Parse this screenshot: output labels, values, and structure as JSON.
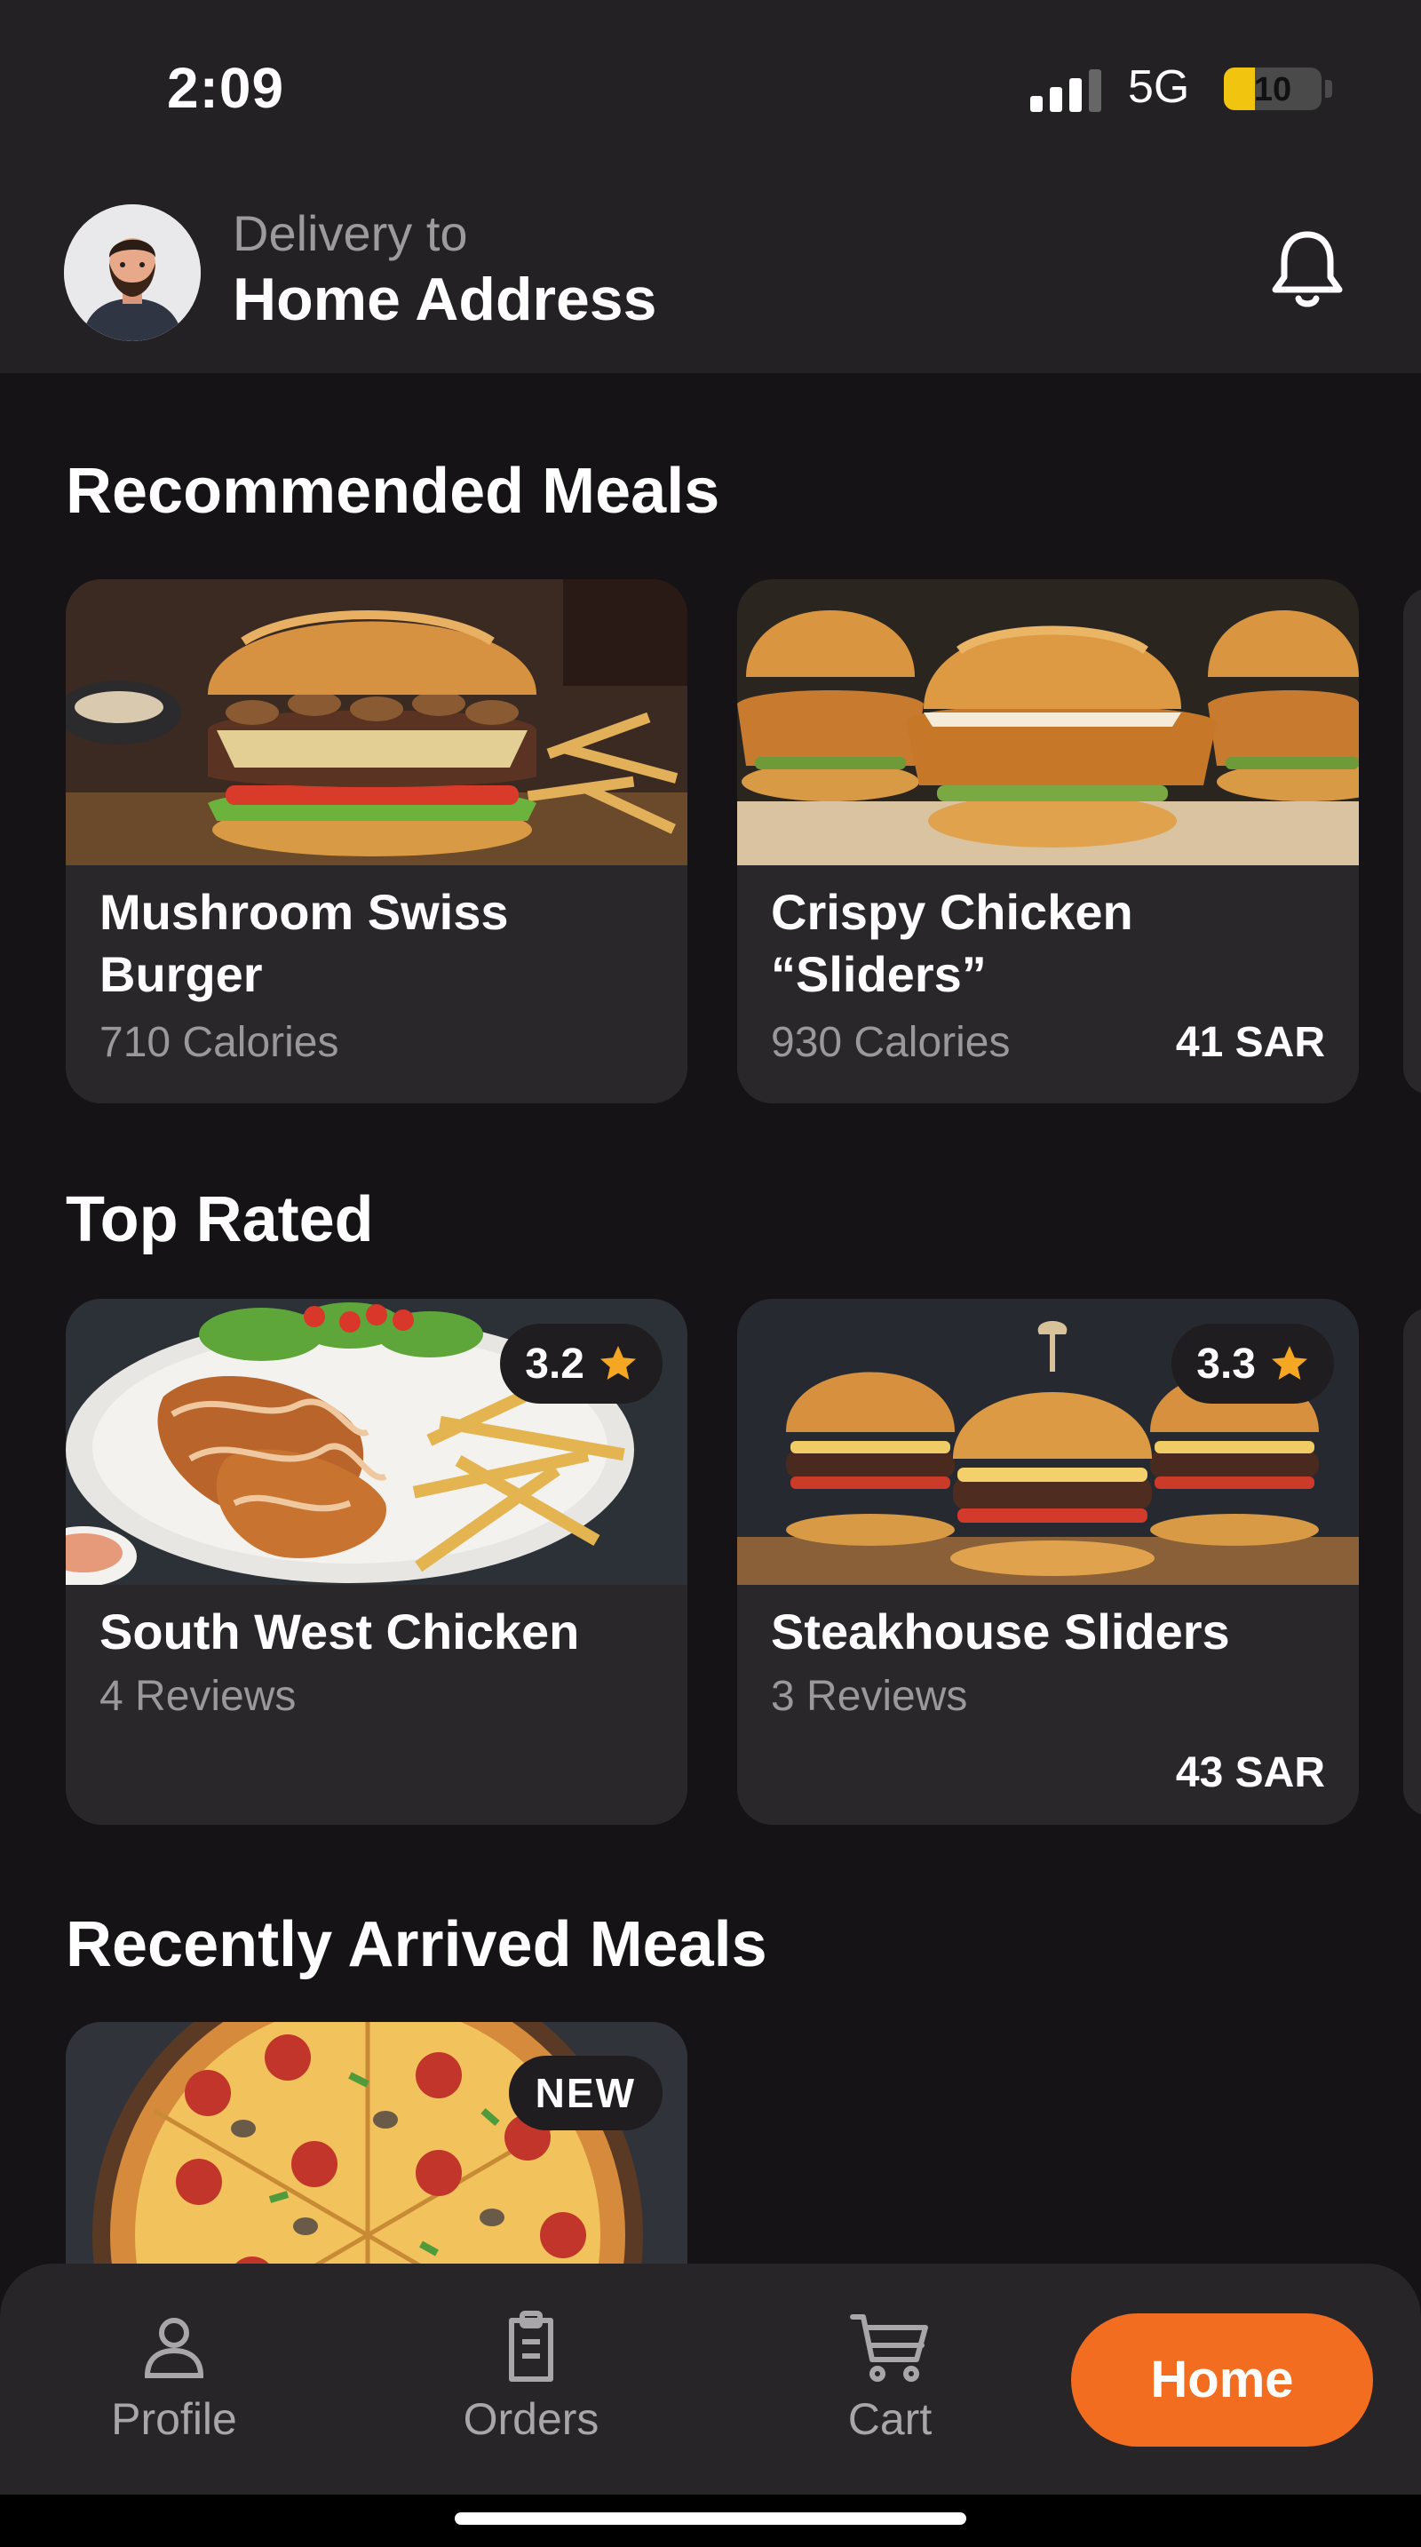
{
  "status_bar": {
    "time": "2:09",
    "network": "5G",
    "battery": "10",
    "battery_level": 0.1
  },
  "header": {
    "delivery_label": "Delivery to",
    "address": "Home Address",
    "avatar_icon": "user-avatar-icon",
    "bell_icon": "bell-icon"
  },
  "sections": {
    "recommended": {
      "title": "Recommended Meals",
      "items": [
        {
          "title": "Mushroom Swiss\nBurger",
          "calories": "710 Calories",
          "price": ""
        },
        {
          "title": "Crispy Chicken\n“Sliders”",
          "calories": "930 Calories",
          "price": "41 SAR"
        }
      ]
    },
    "top_rated": {
      "title": "Top Rated",
      "items": [
        {
          "title": "South West Chicken",
          "reviews": "4 Reviews",
          "rating": "3.2",
          "price": ""
        },
        {
          "title": "Steakhouse Sliders",
          "reviews": "3 Reviews",
          "rating": "3.3",
          "price": "43 SAR"
        }
      ]
    },
    "recent": {
      "title": "Recently Arrived Meals",
      "items": [
        {
          "badge": "NEW"
        }
      ]
    }
  },
  "bottom_nav": {
    "profile": "Profile",
    "orders": "Orders",
    "cart": "Cart",
    "home": "Home"
  },
  "colors": {
    "accent": "#f36d21",
    "background": "#151316",
    "card": "#2a272b",
    "star": "#f5a623"
  }
}
